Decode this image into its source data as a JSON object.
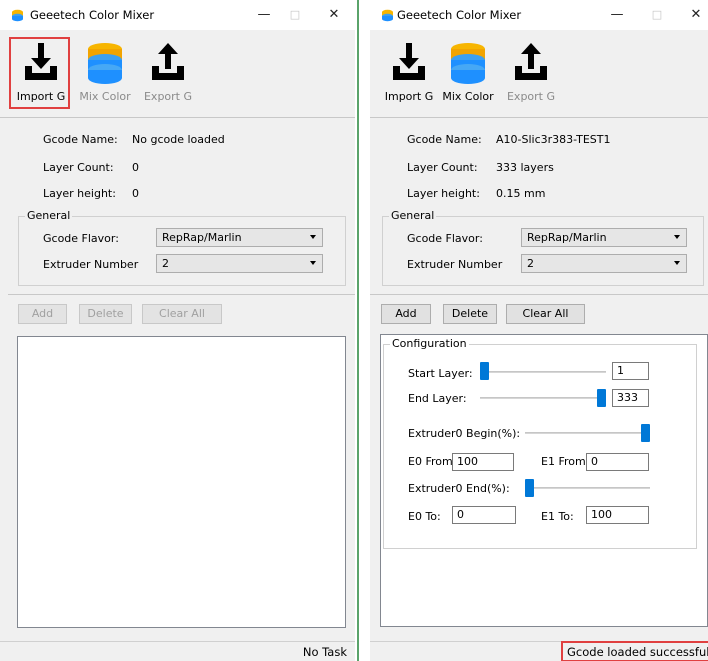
{
  "app": {
    "title": "Geeetech Color Mixer"
  },
  "window_controls": {
    "minimize": "—",
    "maximize": "□",
    "close": "✕"
  },
  "toolbar": {
    "import_label": "Import G",
    "mix_label": "Mix Color",
    "export_label": "Export G"
  },
  "left": {
    "info": {
      "gcode_name_label": "Gcode Name:",
      "gcode_name_value": "No gcode loaded",
      "layer_count_label": "Layer Count:",
      "layer_count_value": "0",
      "layer_height_label": "Layer height:",
      "layer_height_value": "0"
    },
    "general": {
      "title": "General",
      "flavor_label": "Gcode Flavor:",
      "flavor_value": "RepRap/Marlin",
      "extruder_label": "Extruder Number",
      "extruder_value": "2"
    },
    "buttons": {
      "add": "Add",
      "delete": "Delete",
      "clear_all": "Clear All"
    },
    "status": "No Task"
  },
  "right": {
    "info": {
      "gcode_name_label": "Gcode Name:",
      "gcode_name_value": "A10-Slic3r383-TEST1",
      "layer_count_label": "Layer Count:",
      "layer_count_value": "333 layers",
      "layer_height_label": "Layer height:",
      "layer_height_value": "0.15 mm"
    },
    "general": {
      "title": "General",
      "flavor_label": "Gcode Flavor:",
      "flavor_value": "RepRap/Marlin",
      "extruder_label": "Extruder Number",
      "extruder_value": "2"
    },
    "buttons": {
      "add": "Add",
      "delete": "Delete",
      "clear_all": "Clear All"
    },
    "config": {
      "title": "Configuration",
      "start_layer_label": "Start Layer:",
      "start_layer_value": "1",
      "start_layer_slider": 0.0,
      "end_layer_label": "End Layer:",
      "end_layer_value": "333",
      "end_layer_slider": 1.0,
      "begin_label": "Extruder0 Begin(%):",
      "begin_slider": 1.0,
      "e0_from_label": "E0 From:",
      "e0_from_value": "100",
      "e1_from_label": "E1 From:",
      "e1_from_value": "0",
      "end_label": "Extruder0 End(%):",
      "end_slider": 0.0,
      "e0_to_label": "E0 To:",
      "e0_to_value": "0",
      "e1_to_label": "E1 To:",
      "e1_to_value": "100"
    },
    "status": "Gcode loaded successfully!"
  },
  "colors": {
    "accent": "#0078d7",
    "highlight": "#e04040",
    "db_top": "#f7b500",
    "db_bottom": "#1e90ff"
  }
}
